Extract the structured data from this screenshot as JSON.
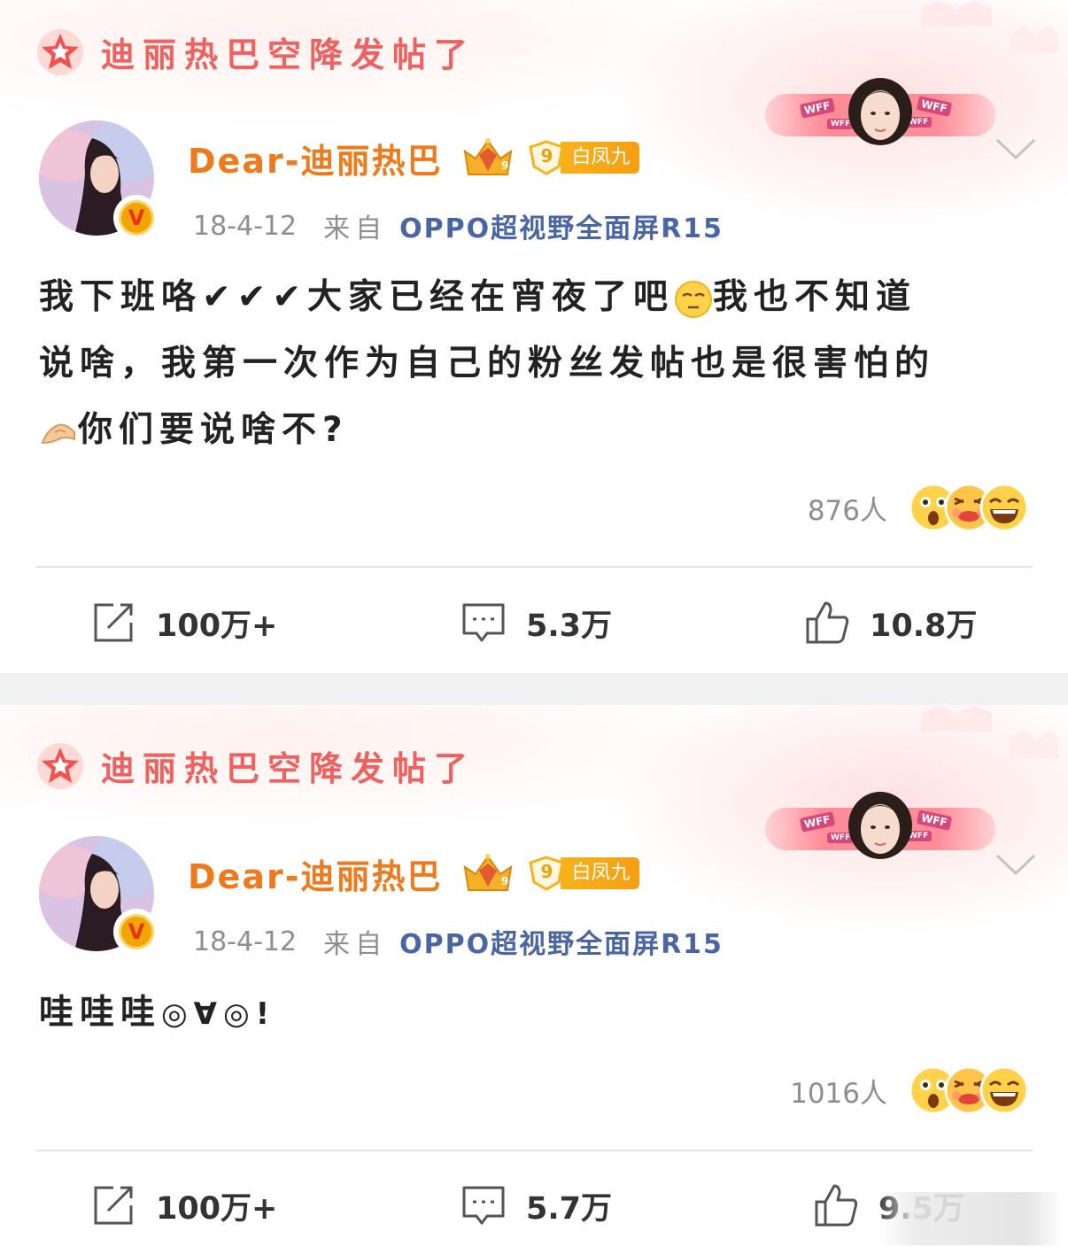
{
  "posts": [
    {
      "banner": "迪丽热巴空降发帖了",
      "username": "Dear-迪丽热巴",
      "fan_badge": {
        "level": "9",
        "title": "白凤九"
      },
      "date": "18-4-12",
      "from_label": "来自",
      "device": "OPPO超视野全面屏R15",
      "body_line1": "我下班咯✔✔✔大家已经在宵夜了吧",
      "body_line1b": "我也不知道",
      "body_line2": "说啥，我第一次作为自己的粉丝发帖也是很害怕的",
      "body_line3": "你们要说啥不?",
      "reaction_count": "876人",
      "actions": {
        "repost": "100万+",
        "comment": "5.3万",
        "like": "10.8万"
      }
    },
    {
      "banner": "迪丽热巴空降发帖了",
      "username": "Dear-迪丽热巴",
      "fan_badge": {
        "level": "9",
        "title": "白凤九"
      },
      "date": "18-4-12",
      "from_label": "来自",
      "device": "OPPO超视野全面屏R15",
      "body_line1": "哇哇哇",
      "body_kaomoji": "◎∀◎!",
      "reaction_count": "1016人",
      "actions": {
        "repost": "100万+",
        "comment": "5.7万",
        "like": "9.5万"
      }
    }
  ],
  "colors": {
    "banner": "#f0605e",
    "username": "#ef7a1b",
    "device": "#4a65a3",
    "meta": "#8e8e8e",
    "fan_badge": "#f6b21b"
  },
  "icons": [
    "star-icon",
    "chevron-down-icon",
    "crown-level-icon",
    "verified-v-icon",
    "repost-icon",
    "comment-icon",
    "like-icon",
    "reaction-surprised-icon",
    "reaction-blush-icon",
    "reaction-laugh-icon"
  ]
}
